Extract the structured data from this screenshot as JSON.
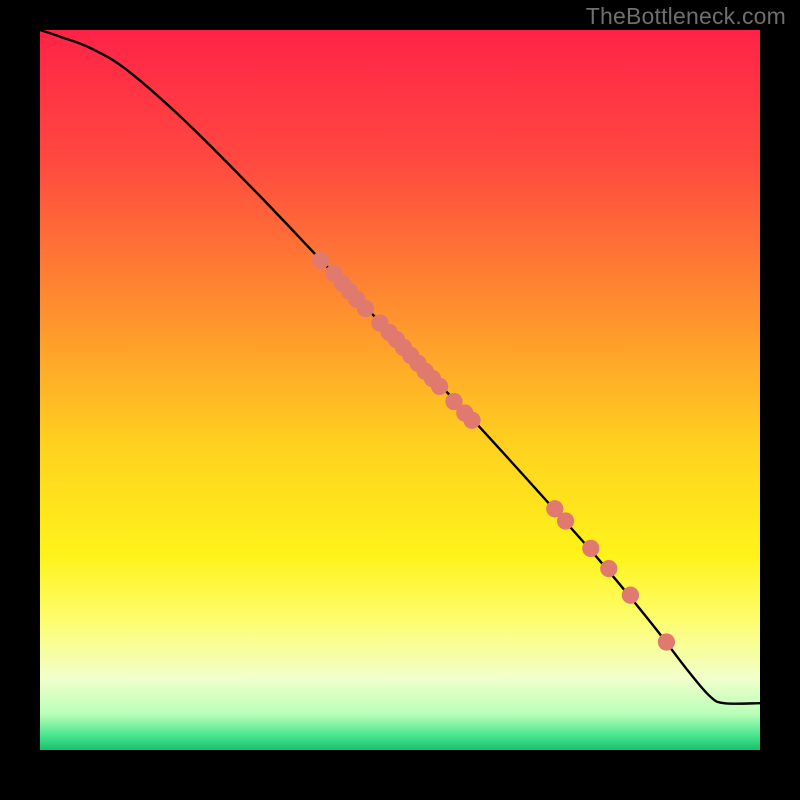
{
  "attribution": "TheBottleneck.com",
  "chart_data": {
    "type": "line",
    "title": "",
    "xlabel": "",
    "ylabel": "",
    "xlim": [
      0,
      100
    ],
    "ylim": [
      0,
      100
    ],
    "background_gradient": {
      "stops": [
        {
          "pct": 0,
          "color": "#ff2347"
        },
        {
          "pct": 18,
          "color": "#ff4840"
        },
        {
          "pct": 38,
          "color": "#ff8c2f"
        },
        {
          "pct": 58,
          "color": "#ffd21f"
        },
        {
          "pct": 73,
          "color": "#fff31a"
        },
        {
          "pct": 82,
          "color": "#fdfd6f"
        },
        {
          "pct": 90,
          "color": "#f2ffca"
        },
        {
          "pct": 95,
          "color": "#b9ffb9"
        },
        {
          "pct": 98,
          "color": "#49e58f"
        },
        {
          "pct": 100,
          "color": "#18c06e"
        }
      ]
    },
    "series": [
      {
        "name": "bottleneck-curve",
        "x": [
          0,
          3,
          7,
          12,
          20,
          30,
          40,
          50,
          60,
          70,
          78,
          85,
          90,
          93,
          95,
          100
        ],
        "y": [
          100,
          99,
          97.5,
          94.5,
          87.5,
          77.5,
          67,
          56.5,
          46,
          35,
          26,
          17.5,
          11,
          7.5,
          6.5,
          6.5
        ]
      }
    ],
    "markers": {
      "name": "highlighted-points",
      "color": "#e07a6e",
      "radius_frac": 0.012,
      "points": [
        {
          "x": 39.0,
          "y": 68.0
        },
        {
          "x": 40.8,
          "y": 66.2
        },
        {
          "x": 42.0,
          "y": 64.8
        },
        {
          "x": 43.0,
          "y": 63.7
        },
        {
          "x": 44.0,
          "y": 62.6
        },
        {
          "x": 45.2,
          "y": 61.3
        },
        {
          "x": 47.2,
          "y": 59.3
        },
        {
          "x": 48.5,
          "y": 58.0
        },
        {
          "x": 49.5,
          "y": 57.0
        },
        {
          "x": 50.5,
          "y": 55.9
        },
        {
          "x": 51.5,
          "y": 54.8
        },
        {
          "x": 52.5,
          "y": 53.7
        },
        {
          "x": 53.5,
          "y": 52.6
        },
        {
          "x": 54.5,
          "y": 51.6
        },
        {
          "x": 55.5,
          "y": 50.5
        },
        {
          "x": 57.5,
          "y": 48.4
        },
        {
          "x": 59.0,
          "y": 46.8
        },
        {
          "x": 60.0,
          "y": 45.8
        },
        {
          "x": 71.5,
          "y": 33.5
        },
        {
          "x": 73.0,
          "y": 31.8
        },
        {
          "x": 76.5,
          "y": 28.0
        },
        {
          "x": 79.0,
          "y": 25.2
        },
        {
          "x": 82.0,
          "y": 21.5
        },
        {
          "x": 87.0,
          "y": 15.0
        }
      ]
    }
  }
}
